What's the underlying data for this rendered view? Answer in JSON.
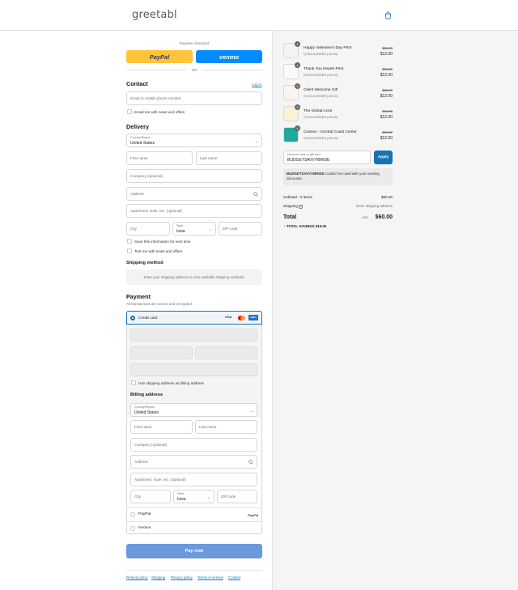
{
  "header": {
    "logo": "greetabl",
    "bag_icon": "shopping-bag-icon",
    "brand_color": "#1773b0"
  },
  "express": {
    "title": "Express checkout",
    "paypal_label": "PayPal",
    "venmo_label": "venmo",
    "or": "OR"
  },
  "contact": {
    "title": "Contact",
    "login": "Log in",
    "email_placeholder": "Email or mobile phone number",
    "newsletter": "Email me with news and offers"
  },
  "delivery": {
    "title": "Delivery",
    "country_label": "Country/Region",
    "country_value": "United States",
    "first_name": "First name",
    "last_name": "Last name",
    "company": "Company (optional)",
    "address": "Address",
    "apartment": "Apartment, suite, etc. (optional)",
    "city": "City",
    "state_label": "State",
    "state_value": "Iowa",
    "zip": "ZIP code",
    "save_info": "Save this information for next time",
    "text_me": "Text me with news and offers"
  },
  "shipping": {
    "title": "Shipping method",
    "note": "Enter your shipping address to view available shipping methods."
  },
  "payment": {
    "title": "Payment",
    "subtitle": "All transactions are secure and encrypted.",
    "credit_card": "Credit card",
    "card_brands": [
      "VISA",
      "MC",
      "AMEX"
    ],
    "use_shipping": "Use shipping address as billing address",
    "paypal": "PayPal",
    "paypal_logo": "PayPal",
    "invoice": "Invoice",
    "pay_now": "Pay now"
  },
  "billing": {
    "title": "Billing address",
    "country_label": "Country/Region",
    "country_value": "United States",
    "first_name": "First name",
    "last_name": "Last name",
    "company": "Company (optional)",
    "address": "Address",
    "apartment": "Apartment, suite, etc. (optional)",
    "city": "City",
    "state_label": "State",
    "state_value": "Iowa",
    "zip": "ZIP code"
  },
  "footer": {
    "links": [
      "Refund policy",
      "Shipping",
      "Privacy policy",
      "Terms of service",
      "Contact"
    ]
  },
  "cart": {
    "items": [
      {
        "name": "Happy Valentine’s Day Print",
        "qty": "4",
        "discount": "BULKORDER (-$3.00)",
        "original": "$15.00",
        "price": "$12.00",
        "thumb_color": "#f3f3f3"
      },
      {
        "name": "Thank You Hearts Print",
        "qty": "4",
        "discount": "BULKORDER (-$3.00)",
        "original": "$15.00",
        "price": "$12.00",
        "thumb_color": "#fafafa"
      },
      {
        "name": "Client Welcome Gift",
        "qty": "3",
        "discount": "BULKORDER (-$3.00)",
        "original": "$15.00",
        "price": "$12.00",
        "thumb_color": "#fbf4ef"
      },
      {
        "name": "The Global Actor",
        "qty": "3",
        "discount": "BULKORDER (-$3.00)",
        "original": "$15.00",
        "price": "$12.00",
        "thumb_color": "#fdf0d8"
      },
      {
        "name": "Custom - Central Coast Center",
        "qty": "4",
        "discount": "BULKORDER (-$3.00)",
        "original": "$15.00",
        "price": "$12.00",
        "thumb_color": "#1fa99a"
      }
    ],
    "discount_label": "Discount code or gift card",
    "discount_value": "BUDGETSAVVYBRIDE",
    "apply": "Apply",
    "error_code": "BUDGETSAVVYBRIDE",
    "error_text": "couldn't be used with your existing discounts.",
    "subtotal_label": "Subtotal · 5 items",
    "subtotal_value": "$60.00",
    "shipping_label": "Shipping",
    "shipping_value": "Enter shipping address",
    "total_label": "Total",
    "currency": "USD",
    "total_value": "$60.00",
    "savings_label": "TOTAL SAVINGS",
    "savings_value": "$15.00"
  }
}
